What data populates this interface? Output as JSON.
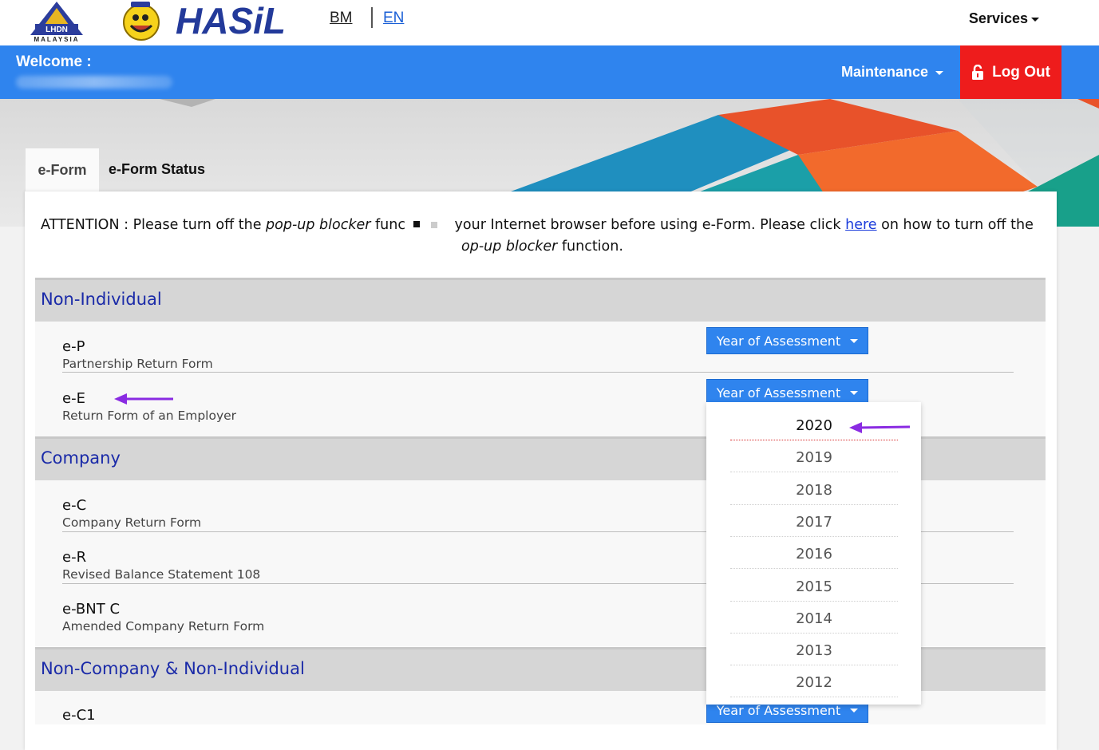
{
  "header": {
    "lhdn_logo_text": "LHDN",
    "lhdn_logo_sub": "MALAYSIA",
    "ezhasil_logo_text": "HASiL",
    "lang_bm": "BM",
    "lang_en": "EN",
    "services_label": "Services"
  },
  "navbar": {
    "welcome_label": "Welcome :",
    "maintenance_label": "Maintenance",
    "logout_label": "Log Out",
    "color_blue": "#2f84ee",
    "color_logout": "#ee1c1c"
  },
  "tabs": {
    "eform": "e-Form",
    "eform_status": "e-Form Status"
  },
  "attention": {
    "prefix": "ATTENTION : Please turn off the ",
    "popup_italic": "pop-up blocker",
    "middle": " func",
    "middle2": "your Internet browser before using e-Form. Please click ",
    "link": "here",
    "suffix": " on how to turn off the ",
    "popup_italic2": "op-up blocker",
    "end": " function."
  },
  "sections": {
    "non_individual": "Non-Individual",
    "company": "Company",
    "non_company": "Non-Company & Non-Individual"
  },
  "forms": {
    "ep": {
      "code": "e-P",
      "desc": "Partnership Return Form"
    },
    "ee": {
      "code": "e-E",
      "desc": "Return Form of an Employer"
    },
    "ec": {
      "code": "e-C",
      "desc": "Company Return Form"
    },
    "er": {
      "code": "e-R",
      "desc": "Revised Balance Statement 108"
    },
    "ebnt": {
      "code": "e-BNT C",
      "desc": "Amended Company Return Form"
    },
    "ec1": {
      "code": "e-C1"
    }
  },
  "yoa_label": "Year of Assessment",
  "dropdown_years": [
    "2020",
    "2019",
    "2018",
    "2017",
    "2016",
    "2015",
    "2014",
    "2013",
    "2012"
  ],
  "annotation_color": "#8a2be2"
}
